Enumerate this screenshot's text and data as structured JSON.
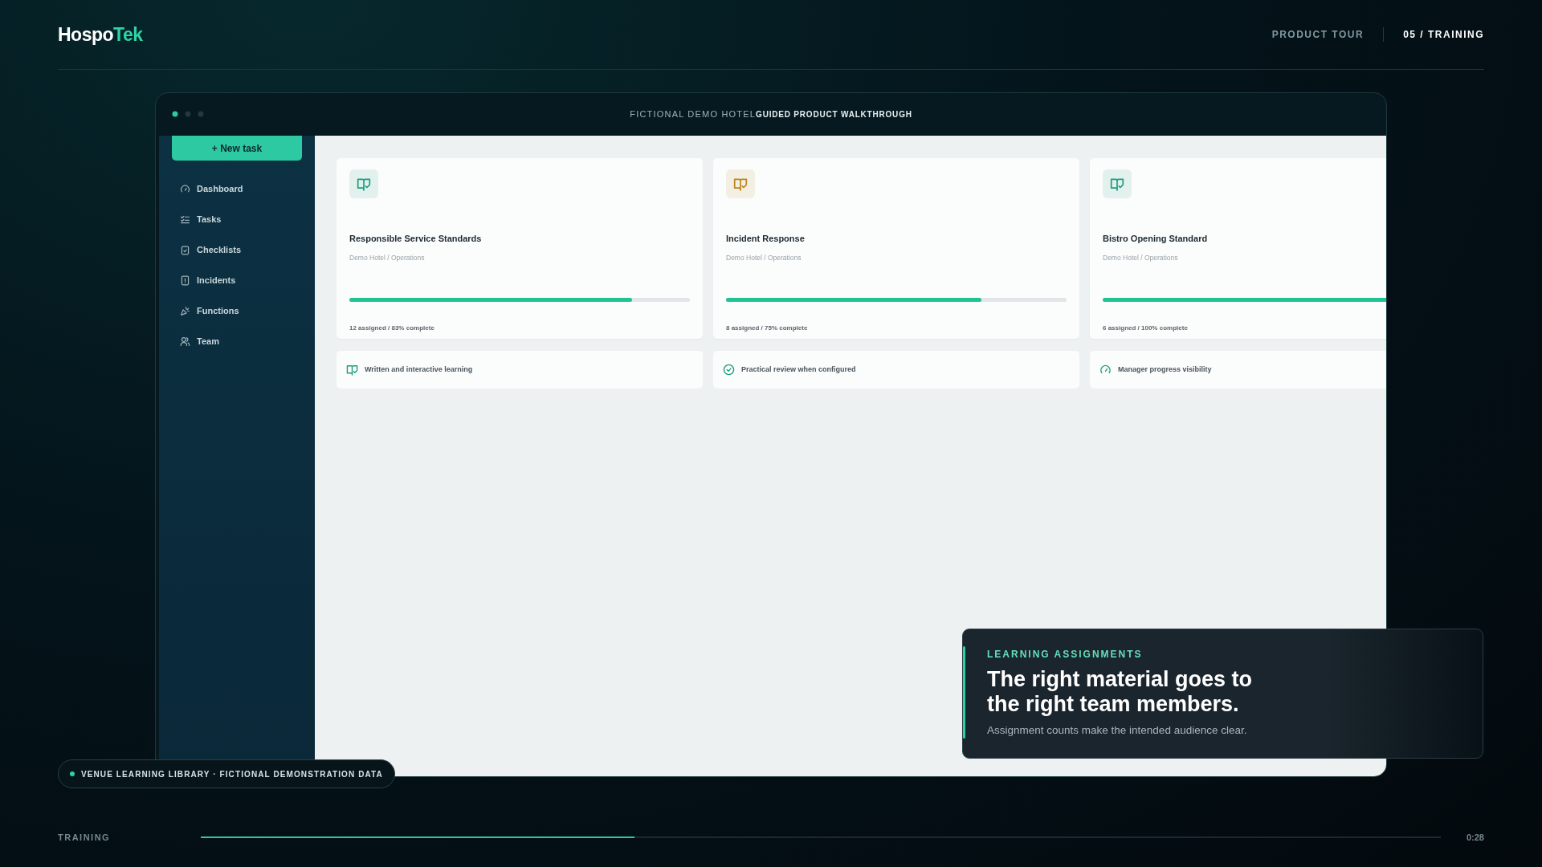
{
  "brand": {
    "part_1": "Hospo",
    "part_2": "Tek"
  },
  "header": {
    "links": [
      {
        "label": "PRODUCT TOUR",
        "selected": false
      },
      {
        "label": "05 / TRAINING",
        "selected": true
      }
    ]
  },
  "window": {
    "title_1": "FICTIONAL DEMO HOTEL",
    "title_2": "GUIDED PRODUCT WALKTHROUGH"
  },
  "sidebar": {
    "button": "+ New task",
    "items": [
      {
        "label": "Dashboard",
        "kind": "gauge"
      },
      {
        "label": "Tasks",
        "kind": "list"
      },
      {
        "label": "Checklists",
        "kind": "clipboard"
      },
      {
        "label": "Incidents",
        "kind": "report"
      },
      {
        "label": "Functions",
        "kind": "popper"
      },
      {
        "label": "Team",
        "kind": "team"
      }
    ]
  },
  "courses": [
    {
      "title": "Responsible Service Standards",
      "subtitle": "Demo Hotel / Operations",
      "level": 0.83,
      "stats": "12 assigned / 83% complete",
      "color": "#1a9e7c"
    },
    {
      "title": "Incident Response",
      "subtitle": "Demo Hotel / Operations",
      "level": 0.75,
      "stats": "8 assigned / 75% complete",
      "color": "#b9851c"
    },
    {
      "title": "Bistro Opening Standard",
      "subtitle": "Demo Hotel / Operations",
      "level": 1.0,
      "stats": "6 assigned / 100% complete",
      "color": "#1a9e7c"
    }
  ],
  "features": [
    {
      "label": "Written and interactive learning",
      "kind": "book"
    },
    {
      "label": "Practical review when configured",
      "kind": "check"
    },
    {
      "label": "Manager progress visibility",
      "kind": "gauge"
    }
  ],
  "callout": {
    "eyebrow": "LEARNING ASSIGNMENTS",
    "headline": "The right material goes to the right team members.",
    "text": "Assignment counts make the intended audience clear."
  },
  "badge": {
    "label": "VENUE LEARNING LIBRARY · FICTIONAL DEMONSTRATION DATA"
  },
  "footer": {
    "section": "TRAINING",
    "level": 0.35,
    "time": "0:28"
  }
}
